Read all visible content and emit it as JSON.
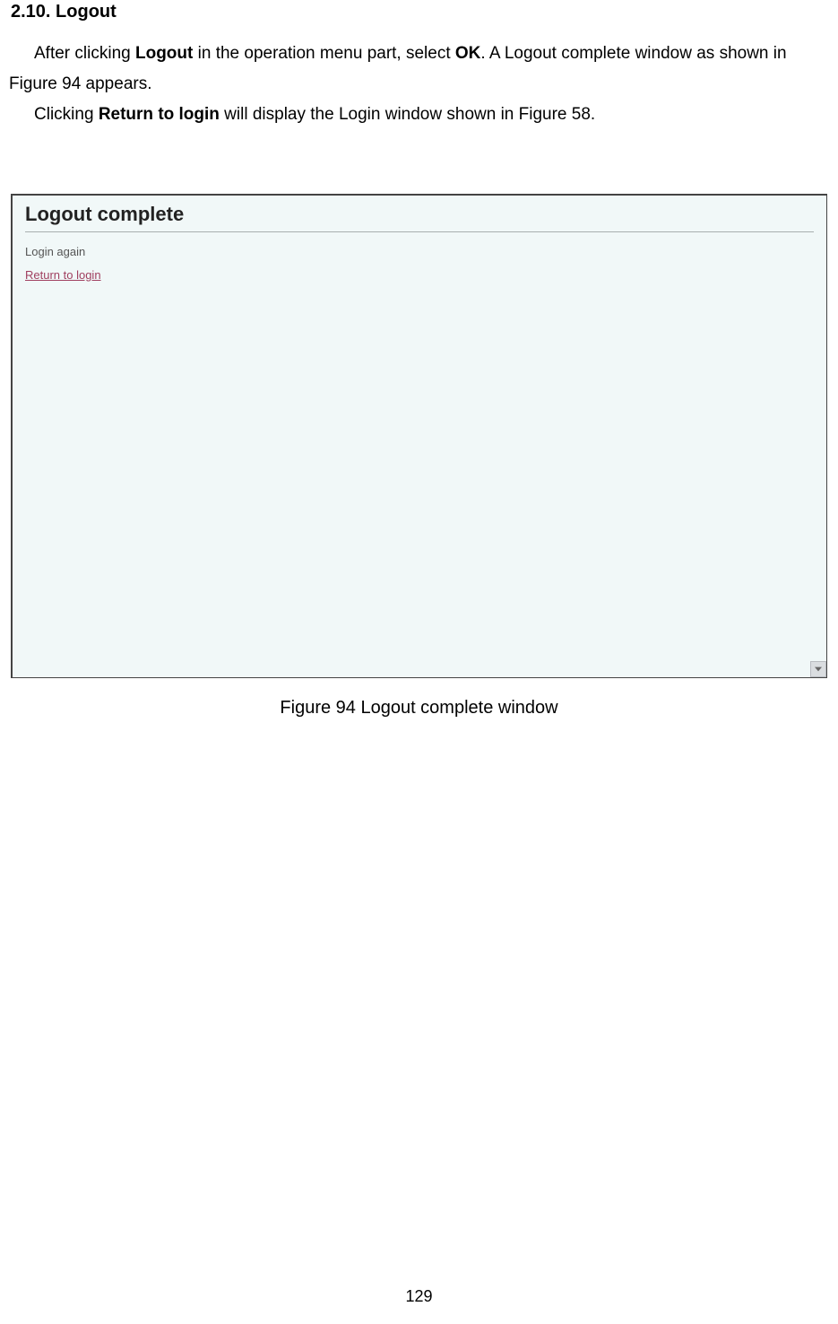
{
  "section": {
    "heading": "2.10. Logout",
    "para1_pre": "After clicking ",
    "para1_bold1": "Logout",
    "para1_mid": " in the operation menu part, select ",
    "para1_bold2": "OK",
    "para1_post": ". A Logout complete window as shown in Figure 94 appears.",
    "para2_pre": "Clicking ",
    "para2_bold": "Return to login",
    "para2_post": " will display the Login window shown in Figure 58."
  },
  "screenshot": {
    "title": "Logout complete",
    "login_again": "Login again",
    "return_link": "Return to login"
  },
  "figure_caption": "Figure 94 Logout complete window",
  "page_number": "129"
}
